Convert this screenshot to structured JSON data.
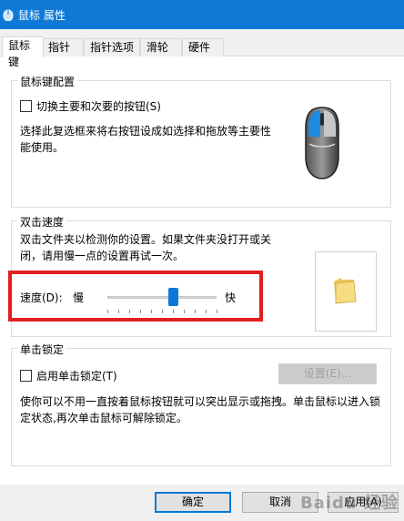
{
  "window": {
    "title": "鼠标 属性"
  },
  "tabs": [
    {
      "label": "鼠标键",
      "active": true
    },
    {
      "label": "指针",
      "active": false
    },
    {
      "label": "指针选项",
      "active": false
    },
    {
      "label": "滑轮",
      "active": false
    },
    {
      "label": "硬件",
      "active": false
    }
  ],
  "button_config": {
    "group_title": "鼠标键配置",
    "swap_checkbox_label": "切换主要和次要的按钮(S)",
    "swap_checked": false,
    "description": "选择此复选框来将右按钮设成如选择和拖放等主要性能使用。"
  },
  "double_click": {
    "group_title": "双击速度",
    "description": "双击文件夹以检测你的设置。如果文件夹没打开或关闭，请用慢一点的设置再试一次。",
    "speed_label": "速度(D):",
    "slow_label": "慢",
    "fast_label": "快",
    "speed_value": 0.6
  },
  "click_lock": {
    "group_title": "单击锁定",
    "enable_checkbox_label": "启用单击锁定(T)",
    "enable_checked": false,
    "settings_button": "设置(E)...",
    "description": "使你可以不用一直按着鼠标按钮就可以突出显示或拖拽。单击鼠标以进入锁定状态,再次单击鼠标可解除锁定。"
  },
  "footer": {
    "ok": "确定",
    "cancel": "取消",
    "apply": "应用(A)"
  },
  "watermark": "Baidu 经验",
  "colors": {
    "titlebar": "#0f7ad5",
    "accent": "#0078d7",
    "highlight": "#e02020"
  }
}
